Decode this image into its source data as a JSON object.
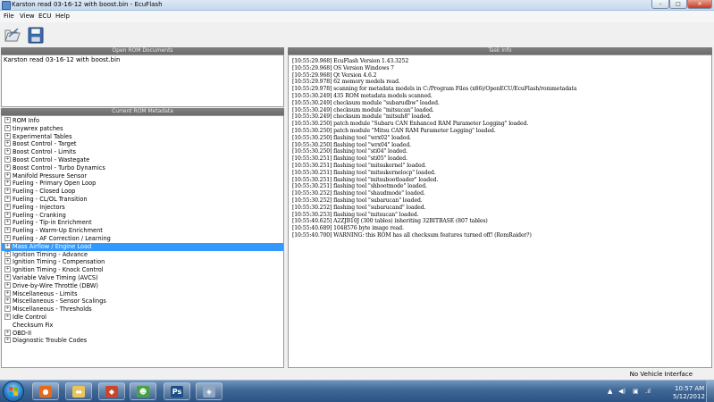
{
  "window": {
    "title": "Karston read 03-16-12 with boost.bin - EcuFlash",
    "minimize": "–",
    "maximize": "□",
    "close": "✕"
  },
  "menu": [
    "File",
    "View",
    "ECU",
    "Help"
  ],
  "toolbar": {
    "icons": [
      "open-icon",
      "save-icon"
    ]
  },
  "open_rom": {
    "header": "Open ROM Documents",
    "items": [
      "Karston read 03-16-12 with boost.bin"
    ]
  },
  "metadata": {
    "header": "Current ROM Metadata",
    "items": [
      {
        "label": "ROM Info",
        "expandable": true,
        "selected": false
      },
      {
        "label": "tinywrex patches",
        "expandable": true,
        "selected": false
      },
      {
        "label": "Experimental Tables",
        "expandable": true,
        "selected": false
      },
      {
        "label": "Boost Control - Target",
        "expandable": true,
        "selected": false
      },
      {
        "label": "Boost Control - Limits",
        "expandable": true,
        "selected": false
      },
      {
        "label": "Boost Control - Wastegate",
        "expandable": true,
        "selected": false
      },
      {
        "label": "Boost Control - Turbo Dynamics",
        "expandable": true,
        "selected": false
      },
      {
        "label": "Manifold Pressure Sensor",
        "expandable": true,
        "selected": false
      },
      {
        "label": "Fueling - Primary Open Loop",
        "expandable": true,
        "selected": false
      },
      {
        "label": "Fueling - Closed Loop",
        "expandable": true,
        "selected": false
      },
      {
        "label": "Fueling - CL/OL Transition",
        "expandable": true,
        "selected": false
      },
      {
        "label": "Fueling - Injectors",
        "expandable": true,
        "selected": false
      },
      {
        "label": "Fueling - Cranking",
        "expandable": true,
        "selected": false
      },
      {
        "label": "Fueling - Tip-in Enrichment",
        "expandable": true,
        "selected": false
      },
      {
        "label": "Fueling - Warm-Up Enrichment",
        "expandable": true,
        "selected": false
      },
      {
        "label": "Fueling - AF Correction / Learning",
        "expandable": true,
        "selected": false
      },
      {
        "label": "Mass Airflow / Engine Load",
        "expandable": true,
        "selected": true
      },
      {
        "label": "Ignition Timing - Advance",
        "expandable": true,
        "selected": false
      },
      {
        "label": "Ignition Timing - Compensation",
        "expandable": true,
        "selected": false
      },
      {
        "label": "Ignition Timing - Knock Control",
        "expandable": true,
        "selected": false
      },
      {
        "label": "Variable Valve Timing (AVCS)",
        "expandable": true,
        "selected": false
      },
      {
        "label": "Drive-by-Wire Throttle (DBW)",
        "expandable": true,
        "selected": false
      },
      {
        "label": "Miscellaneous - Limits",
        "expandable": true,
        "selected": false
      },
      {
        "label": "Miscellaneous - Sensor Scalings",
        "expandable": true,
        "selected": false
      },
      {
        "label": "Miscellaneous - Thresholds",
        "expandable": true,
        "selected": false
      },
      {
        "label": "Idle Control",
        "expandable": true,
        "selected": false
      },
      {
        "label": "Checksum Fix",
        "expandable": false,
        "selected": false
      },
      {
        "label": "OBD-II",
        "expandable": true,
        "selected": false
      },
      {
        "label": "Diagnostic Trouble Codes",
        "expandable": true,
        "selected": false
      }
    ]
  },
  "task_info": {
    "header": "Task Info",
    "lines": [
      "[10:55:29.968] EcuFlash Version 1.43.3252",
      "[10:55:29.968] OS Version Windows 7",
      "[10:55:29.968] Qt Version 4.6.2",
      "[10:55:29.978] 62 memory models read.",
      "[10:55:29.978] scanning for metadata models in C:/Program Files (x86)/OpenECU/EcuFlash/rommetadata",
      "[10:55:30.249] 435 ROM metadata models scanned.",
      "[10:55:30.249] checksum module \"subarudbw\" loaded.",
      "[10:55:30.249] checksum module \"mitsucan\" loaded.",
      "[10:55:30.249] checksum module \"mitsuh8\" loaded.",
      "[10:55:30.250] patch module \"Subaru CAN Enhanced RAM Parameter Logging\" loaded.",
      "[10:55:30.250] patch module \"Mitsu CAN RAM Parameter Logging\" loaded.",
      "[10:55:30.250] flashing tool \"wrx02\" loaded.",
      "[10:55:30.250] flashing tool \"wrx04\" loaded.",
      "[10:55:30.250] flashing tool \"sti04\" loaded.",
      "[10:55:30.251] flashing tool \"sti05\" loaded.",
      "[10:55:30.251] flashing tool \"mitsukernel\" loaded.",
      "[10:55:30.251] flashing tool \"mitsukernelocp\" loaded.",
      "[10:55:30.251] flashing tool \"mitsubootloader\" loaded.",
      "[10:55:30.251] flashing tool \"shbootmode\" loaded.",
      "[10:55:30.252] flashing tool \"shaudmode\" loaded.",
      "[10:55:30.252] flashing tool \"subarucan\" loaded.",
      "[10:55:30.252] flashing tool \"subarucand\" loaded.",
      "[10:55:30.253] flashing tool \"mitsucan\" loaded.",
      "[10:55:40.625] A2ZJB10J (300 tables) inheriting 32BITBASE (807 tables)",
      "[10:55:40.689] 1048576 byte image read.",
      "[10:55:40.700] WARNING: this ROM has all checksum features turned off! (RomRaider?)"
    ]
  },
  "status": {
    "text": "No Vehicle Interface"
  },
  "taskbar": {
    "apps": [
      {
        "icon": "firefox-icon",
        "glyph": "●",
        "color": "#e66a1c"
      },
      {
        "icon": "folder-icon",
        "glyph": "▬",
        "color": "#e8c45a"
      },
      {
        "icon": "app-cube-icon",
        "glyph": "◆",
        "color": "#c8462c"
      },
      {
        "icon": "users-icon",
        "glyph": "☻",
        "color": "#4aa04a"
      },
      {
        "icon": "photoshop-icon",
        "glyph": "Ps",
        "color": "#1d4f86"
      },
      {
        "icon": "ecuflash-icon",
        "glyph": "◈",
        "color": "#8ea6c2"
      }
    ],
    "tray": {
      "time": "10:57 AM",
      "date": "5/12/2012"
    }
  }
}
